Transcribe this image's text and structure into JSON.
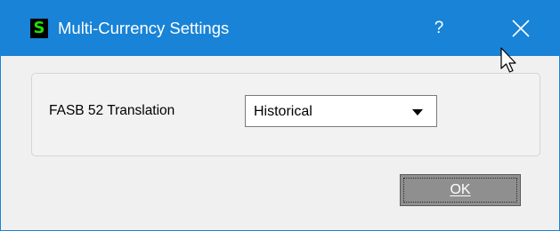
{
  "window": {
    "title": "Multi-Currency Settings",
    "app_icon_glyph": "S",
    "help_label": "?",
    "titlebar_color": "#1883d7"
  },
  "settings": {
    "translation_label": "FASB 52 Translation",
    "translation_value": "Historical"
  },
  "actions": {
    "ok_label": "OK"
  },
  "icons": {
    "app": "sage-s-icon",
    "close": "close-icon",
    "dropdown": "chevron-down-icon",
    "pointer": "mouse-cursor-icon"
  }
}
